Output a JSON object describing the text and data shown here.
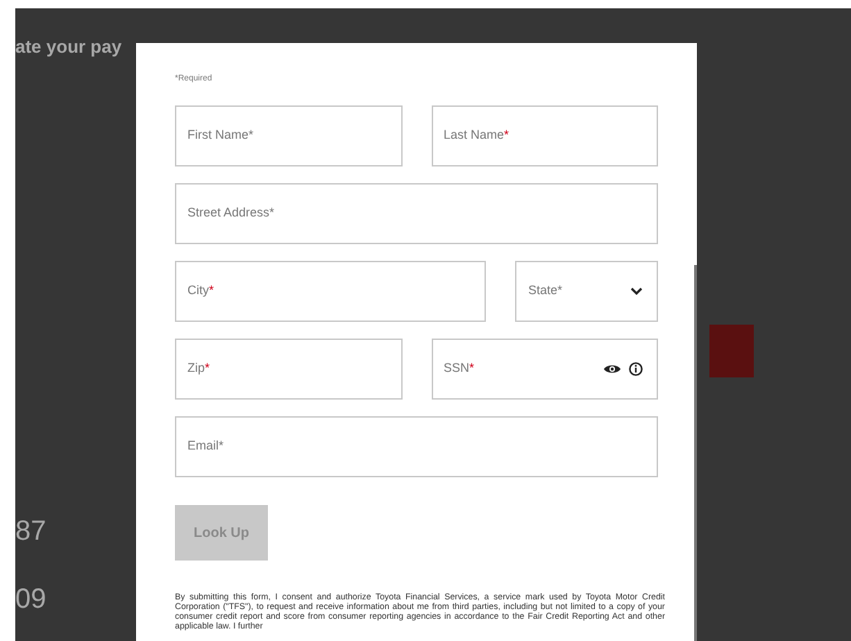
{
  "background": {
    "heading": "ate your pay",
    "amounts": [
      "87",
      "09"
    ]
  },
  "modal": {
    "required_note": "*Required",
    "rows": [
      [
        {
          "label": "First Name",
          "mark": "*",
          "mark_red": false,
          "kind": "text"
        },
        {
          "label": "Last Name",
          "mark": "*",
          "mark_red": true,
          "kind": "text"
        }
      ],
      [
        {
          "label": "Street Address",
          "mark": "*",
          "mark_red": false,
          "kind": "text"
        }
      ],
      [
        {
          "label": "City",
          "mark": "*",
          "mark_red": true,
          "kind": "text"
        },
        {
          "label": "State",
          "mark": "*",
          "mark_red": false,
          "kind": "select"
        }
      ],
      [
        {
          "label": "Zip",
          "mark": "*",
          "mark_red": true,
          "kind": "text"
        },
        {
          "label": "SSN",
          "mark": "*",
          "mark_red": true,
          "kind": "secret"
        }
      ],
      [
        {
          "label": "Email",
          "mark": "*",
          "mark_red": false,
          "kind": "text"
        }
      ]
    ],
    "button": {
      "label": "Look Up",
      "disabled": true
    },
    "disclaimer": "By submitting this form, I consent and authorize Toyota Financial Services, a service mark used by Toyota Motor Credit Corporation (\"TFS\"), to request and receive information about me from third parties, including but not limited to a copy of your consumer credit report and score from consumer reporting agencies in accordance to the Fair Credit Reporting Act and other applicable law. I further"
  }
}
